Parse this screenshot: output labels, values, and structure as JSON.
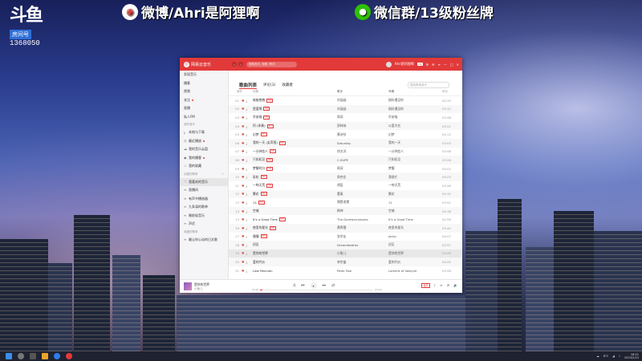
{
  "overlay": {
    "douyu_logo": "斗鱼",
    "room_label": "房间号",
    "room_number": "1368050",
    "weibo_icon": "weibo-icon",
    "weibo_text": "微博/Ahri是阿狸啊",
    "wechat_icon": "wechat-icon",
    "wechat_text": "微信群/13级粉丝牌"
  },
  "app": {
    "title": "网易云音乐",
    "search_placeholder": "搜索音乐, 视频, 歌词",
    "username": "Ahri是阿狸啊",
    "vip_badge": "VIP",
    "nav_back": "‹",
    "nav_forward": "›",
    "window_controls": [
      "≡",
      "—",
      "□",
      "×"
    ]
  },
  "sidebar": {
    "top_items": [
      {
        "label": "发现音乐"
      },
      {
        "label": "播客"
      },
      {
        "label": "视频"
      },
      {
        "label": "关注",
        "dot": true
      },
      {
        "label": "直播"
      },
      {
        "label": "私人FM"
      }
    ],
    "my_music_head": "我的音乐",
    "my_items": [
      {
        "icon": "download-icon",
        "label": "本地与下载"
      },
      {
        "icon": "clock-icon",
        "label": "最近播放",
        "dot": true
      },
      {
        "icon": "cloud-icon",
        "label": "我的音乐云盘"
      },
      {
        "icon": "podcast-icon",
        "label": "我的播客",
        "dot": true
      },
      {
        "icon": "star-icon",
        "label": "我的收藏"
      }
    ],
    "created_head": "创建的歌单",
    "created_add": "+",
    "created_items": [
      {
        "icon": "heart-icon",
        "label": "我喜欢的音乐",
        "active": true
      },
      {
        "icon": "list-icon",
        "label": "直播间"
      },
      {
        "icon": "list-icon",
        "label": "有声书播放器"
      },
      {
        "icon": "list-icon",
        "label": "九条凛的歌单"
      },
      {
        "icon": "list-icon",
        "label": "睡前轻音乐"
      },
      {
        "icon": "list-icon",
        "label": "声优"
      }
    ],
    "fav_head": "收藏的歌单",
    "fav_items": [
      {
        "icon": "list-icon",
        "label": "最让你心动的日文歌"
      }
    ]
  },
  "playlist": {
    "tabs": [
      {
        "label": "歌曲列表",
        "active": true
      },
      {
        "label": "评论(3)",
        "active": false
      },
      {
        "label": "收藏者",
        "active": false
      }
    ],
    "search_placeholder": "搜索歌单音乐",
    "columns": {
      "no": "操作",
      "title": "标题",
      "artist": "歌手",
      "album": "专辑",
      "duration": "时长"
    },
    "rows": [
      {
        "no": "01",
        "title": "偷偷抱抱",
        "tag": "SQ",
        "artist": "刘涵涵",
        "album": "刚好遇见你",
        "duration": "02:33"
      },
      {
        "no": "02",
        "title": "是爱啊",
        "tag": "SQ",
        "artist": "刘涵涵",
        "album": "刚好遇见你",
        "duration": "03:12"
      },
      {
        "no": "03",
        "title": "早安喵",
        "tag": "SQ",
        "artist": "周深",
        "album": "早安喵",
        "duration": "02:48"
      },
      {
        "no": "04",
        "title": "阿 (伴奏)",
        "tag": "SQ",
        "artist": "邵林纳",
        "album": "以爱为名",
        "duration": "03:21"
      },
      {
        "no": "05",
        "title": "幻梦",
        "tag": "SQ",
        "artist": "黄诗扶",
        "album": "幻梦",
        "duration": "04:13"
      },
      {
        "no": "06",
        "title": "我的一天 (女声版)",
        "tag": "SQ",
        "artist": "Saturday",
        "album": "我的一天",
        "duration": "03:05"
      },
      {
        "no": "07",
        "title": "一分钟恋人",
        "tag": "SQ",
        "artist": "徐艺洋",
        "album": "一分钟恋人",
        "duration": "03:58"
      },
      {
        "no": "08",
        "title": "只如初见",
        "tag": "SQ",
        "artist": "C-SUPE",
        "album": "只如初见",
        "duration": "03:26"
      },
      {
        "no": "09",
        "title": "梦醒时分",
        "tag": "SQ",
        "artist": "周深",
        "album": "梦醒",
        "duration": "04:02"
      },
      {
        "no": "10",
        "title": "彩虹",
        "tag": "SQ",
        "artist": "周杰伦",
        "album": "我很忙",
        "duration": "04:23"
      },
      {
        "no": "11",
        "title": "一吻天荒",
        "tag": "SQ",
        "artist": "胡夏",
        "album": "一吻天荒",
        "duration": "03:46"
      },
      {
        "no": "12",
        "title": "繁花",
        "tag": "SQ",
        "artist": "董真",
        "album": "繁花",
        "duration": "04:10"
      },
      {
        "no": "13",
        "title": "11",
        "tag": "SQ",
        "artist": "隔壁老樊",
        "album": "11",
        "duration": "03:52"
      },
      {
        "no": "14",
        "title": "空城",
        "tag": "",
        "artist": "杨坤",
        "album": "空城",
        "duration": "04:18"
      },
      {
        "no": "15",
        "title": "It's a Good Time",
        "tag": "SQ",
        "artist": "The Dontworrybouts",
        "album": "It's a Good Time",
        "duration": "02:56"
      },
      {
        "no": "16",
        "title": "夜里的星光",
        "tag": "SQ",
        "artist": "黄霄雲",
        "album": "夜里的星光",
        "duration": "03:40"
      },
      {
        "no": "17",
        "title": "慢慢",
        "tag": "SQ",
        "artist": "张学友",
        "album": "Jacky",
        "duration": "04:07"
      },
      {
        "no": "18",
        "title": "初见",
        "tag": "",
        "artist": "Dreamfeather",
        "album": "初见",
        "duration": "02:57"
      },
      {
        "no": "19",
        "title": "是你的世界",
        "tag": "",
        "artist": "小鱼儿",
        "album": "是你的世界",
        "duration": "03:29",
        "playing": true
      },
      {
        "no": "20",
        "title": "爱的代价",
        "tag": "",
        "artist": "李宗盛",
        "album": "爱的代价",
        "duration": "04:55"
      },
      {
        "no": "21",
        "title": "Last Reunion",
        "tag": "",
        "artist": "Peter Roe",
        "album": "Lament of Valkyrie",
        "duration": "03:58"
      }
    ]
  },
  "player": {
    "cover_icon": "album-cover",
    "now_title": "是你的世界",
    "now_artist": "小鱼儿",
    "current_time": "00:01",
    "total_time": "03:29",
    "progress": 0.02,
    "controls": [
      "⤨",
      "⏮",
      "⏸",
      "⏭",
      "⇄"
    ],
    "quality": "极高",
    "right_icons": [
      "♪",
      "≡",
      "♬",
      "🔊"
    ]
  },
  "taskbar": {
    "temperature": "8°C",
    "time": "16:21",
    "date": "2023/2/15"
  },
  "colors": {
    "accent": "#e23a3a",
    "sidebar": "#f5f5f7",
    "taskbar": "#1f2230"
  }
}
